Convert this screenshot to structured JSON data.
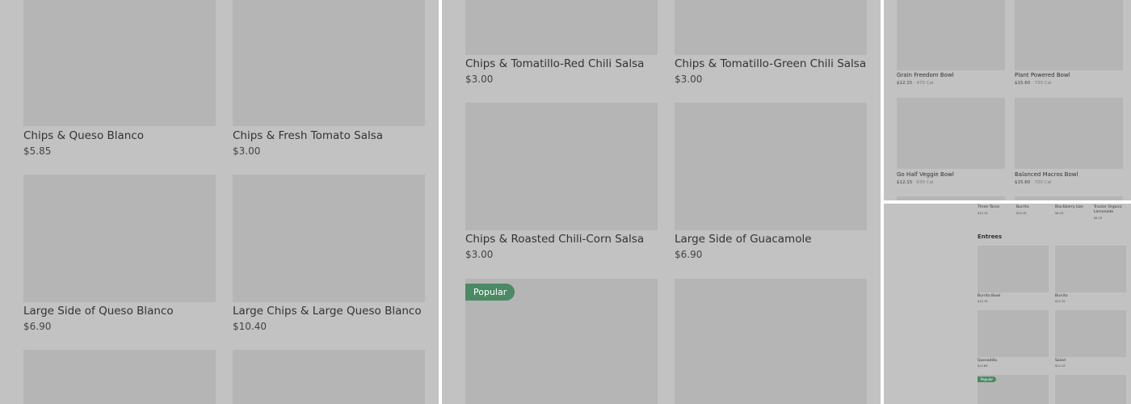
{
  "panel1": {
    "items": [
      {
        "name": "Chips & Queso Blanco",
        "price": "$5.85"
      },
      {
        "name": "Chips & Fresh Tomato Salsa",
        "price": "$3.00"
      },
      {
        "name": "Large Side of Queso Blanco",
        "price": "$6.90"
      },
      {
        "name": "Large Chips & Large Queso Blanco",
        "price": "$10.40"
      }
    ]
  },
  "panel2": {
    "items": [
      {
        "name": "Chips & Tomatillo-Red Chili Salsa",
        "price": "$3.00"
      },
      {
        "name": "Chips & Tomatillo-Green Chili Salsa",
        "price": "$3.00"
      },
      {
        "name": "Chips & Roasted Chili-Corn Salsa",
        "price": "$3.00"
      },
      {
        "name": "Large Side of Guacamole",
        "price": "$6.90"
      }
    ],
    "badge": "Popular"
  },
  "panel3": {
    "items": [
      {
        "name": "Grain Freedom Bowl",
        "price": "$12.15",
        "sep": " · ",
        "cal": "470 Cal"
      },
      {
        "name": "Plant Powered Bowl",
        "price": "$15.60",
        "sep": " · ",
        "cal": "730 Cal"
      },
      {
        "name": "Go Half Veggie Bowl",
        "price": "$12.15",
        "sep": " · ",
        "cal": "630 Cal"
      },
      {
        "name": "Balanced Macros Bowl",
        "price": "$15.60",
        "sep": " · ",
        "cal": "700 Cal"
      }
    ]
  },
  "panel4": {
    "top_items": [
      {
        "name": "Three Tacos",
        "price": "$12.15"
      },
      {
        "name": "Burrito",
        "price": "$12.15"
      },
      {
        "name": "Blackberry Izze",
        "price": "$4.15"
      },
      {
        "name": "Tractor Organic Lemonade",
        "price": "$4.15"
      }
    ],
    "section_title": "Entrees",
    "items": [
      {
        "name": "Burrito Bowl",
        "price": "$12.15"
      },
      {
        "name": "Burrito",
        "price": "$12.15"
      },
      {
        "name": "Quesadilla",
        "price": "$12.85"
      },
      {
        "name": "Salad",
        "price": "$12.15"
      }
    ],
    "badge": "Popular"
  },
  "colors": {
    "panel_bg": "#c2c2c2",
    "image_placeholder": "#b5b5b5",
    "badge": "#4a8a64"
  }
}
